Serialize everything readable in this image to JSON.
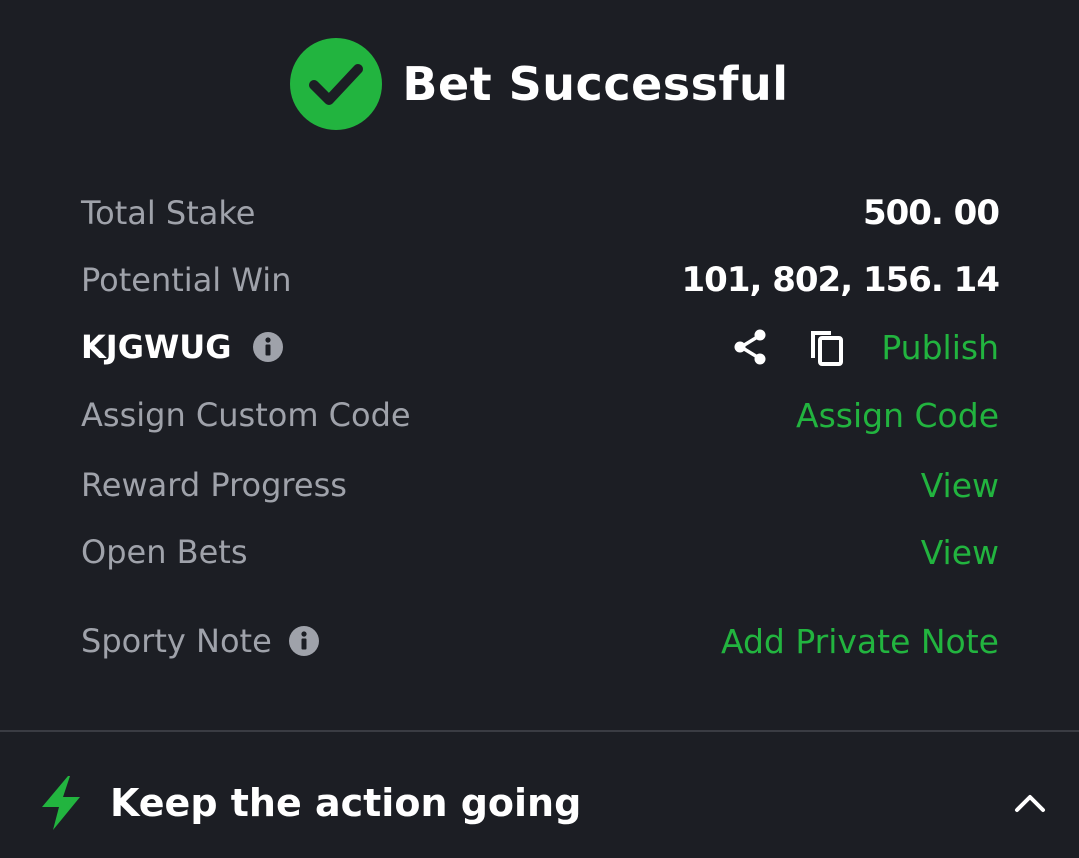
{
  "header": {
    "title": "Bet Successful",
    "status_icon": "check-circle-icon"
  },
  "rows": {
    "total_stake": {
      "label": "Total Stake",
      "value": "500. 00"
    },
    "potential_win": {
      "label": "Potential Win",
      "value": "101, 802, 156. 14"
    },
    "booking_code": {
      "code": "KJGWUG",
      "info_icon": "info-icon",
      "share_icon": "share-icon",
      "copy_icon": "copy-icon",
      "publish_label": "Publish"
    },
    "custom_code": {
      "label": "Assign Custom Code",
      "action": "Assign Code"
    },
    "reward_progress": {
      "label": "Reward Progress",
      "action": "View"
    },
    "open_bets": {
      "label": "Open Bets",
      "action": "View"
    },
    "sporty_note": {
      "label": "Sporty Note",
      "info_icon": "info-icon",
      "action": "Add Private Note"
    }
  },
  "footer": {
    "title": "Keep the action going",
    "icon": "lightning-icon",
    "toggle_icon": "chevron-up-icon"
  },
  "colors": {
    "background": "#1c1e24",
    "accent_green": "#22b43f",
    "label_gray": "#9fa2aa",
    "divider": "#3a3c43"
  }
}
